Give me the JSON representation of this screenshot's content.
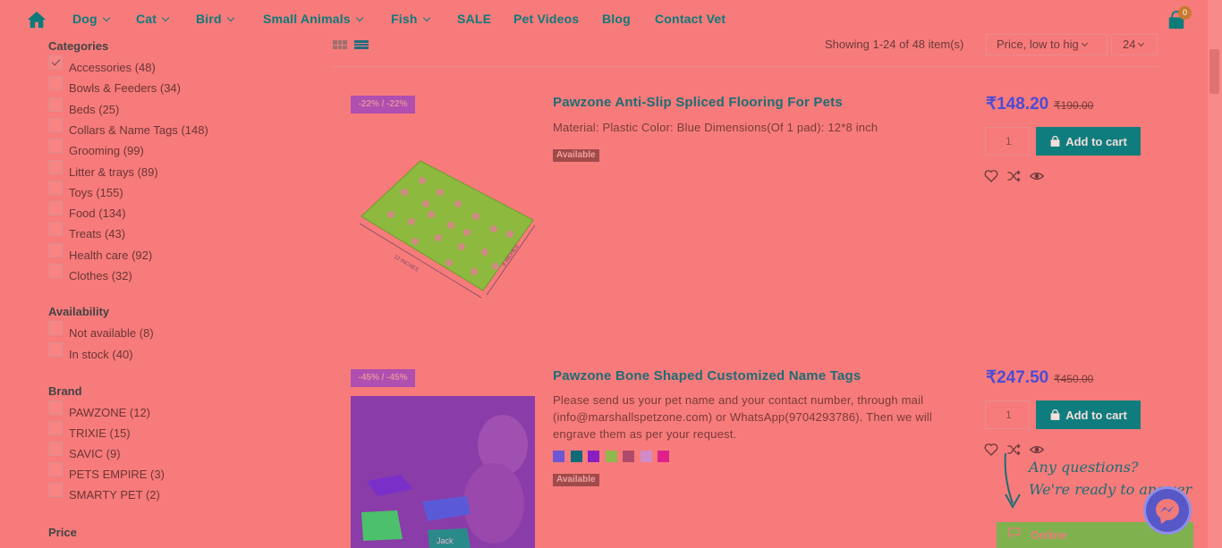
{
  "nav": {
    "items": [
      {
        "label": "Dog",
        "has_dropdown": true
      },
      {
        "label": "Cat",
        "has_dropdown": true
      },
      {
        "label": "Bird",
        "has_dropdown": true
      },
      {
        "label": "Small Animals",
        "has_dropdown": true
      },
      {
        "label": "Fish",
        "has_dropdown": true
      },
      {
        "label": "SALE",
        "has_dropdown": false
      },
      {
        "label": "Pet Videos",
        "has_dropdown": false
      },
      {
        "label": "Blog",
        "has_dropdown": false
      },
      {
        "label": "Contact Vet",
        "has_dropdown": false
      }
    ],
    "cart_count": "0"
  },
  "sidebar": {
    "categories_heading": "Categories",
    "categories": [
      {
        "label": "Accessories (48)",
        "checked": true
      },
      {
        "label": "Bowls & Feeders (34)",
        "checked": false
      },
      {
        "label": "Beds (25)",
        "checked": false
      },
      {
        "label": "Collars & Name Tags (148)",
        "checked": false
      },
      {
        "label": "Grooming (99)",
        "checked": false
      },
      {
        "label": "Litter & trays (89)",
        "checked": false
      },
      {
        "label": "Toys (155)",
        "checked": false
      },
      {
        "label": "Food (134)",
        "checked": false
      },
      {
        "label": "Treats (43)",
        "checked": false
      },
      {
        "label": "Health care (92)",
        "checked": false
      },
      {
        "label": "Clothes (32)",
        "checked": false
      }
    ],
    "availability_heading": "Availability",
    "availability": [
      {
        "label": "Not available (8)",
        "checked": false
      },
      {
        "label": "In stock (40)",
        "checked": false
      }
    ],
    "brand_heading": "Brand",
    "brands": [
      {
        "label": "PAWZONE (12)",
        "checked": false
      },
      {
        "label": "TRIXIE (15)",
        "checked": false
      },
      {
        "label": "SAVIC (9)",
        "checked": false
      },
      {
        "label": "PETS EMPIRE (3)",
        "checked": false
      },
      {
        "label": "SMARTY PET (2)",
        "checked": false
      }
    ],
    "price_heading": "Price"
  },
  "toolbar": {
    "showing": "Showing 1-24 of 48 item(s)",
    "sort_value": "Price, low to hig",
    "per_page": "24"
  },
  "products": [
    {
      "discount": "-22% / -22%",
      "title": "Pawzone Anti-Slip Spliced Flooring For Pets",
      "description": "Material: Plastic Color: Blue Dimensions(Of 1 pad): 12*8 inch",
      "availability": "Available",
      "price": "₹148.20",
      "old_price": "₹190.00",
      "qty": "1",
      "add_to_cart": "Add to cart",
      "image_label_length": "12 INCHES",
      "image_label_width": "8 INCHES"
    },
    {
      "discount": "-45% / -45%",
      "title": "Pawzone Bone Shaped Customized Name Tags",
      "description": "Please send us your pet name and your contact number, through mail (info@marshallspetzone.com) or WhatsApp(9704293786). Then we will engrave them as per your request.",
      "availability": "Available",
      "price": "₹247.50",
      "old_price": "₹450.00",
      "qty": "1",
      "add_to_cart": "Add to cart",
      "swatches": [
        "#6e57d6",
        "#0f6a78",
        "#8a1ec0",
        "#8fb84d",
        "#b04a6a",
        "#d08cc8",
        "#e0208a"
      ],
      "tag_text_1": "Jack"
    }
  ],
  "chat": {
    "question_line1": "Any questions?",
    "question_line2": "We're ready to answer",
    "status": "Online"
  },
  "colors": {
    "background": "#f77b7b",
    "accent": "#0f7d7d",
    "price": "#4d4bd4"
  }
}
